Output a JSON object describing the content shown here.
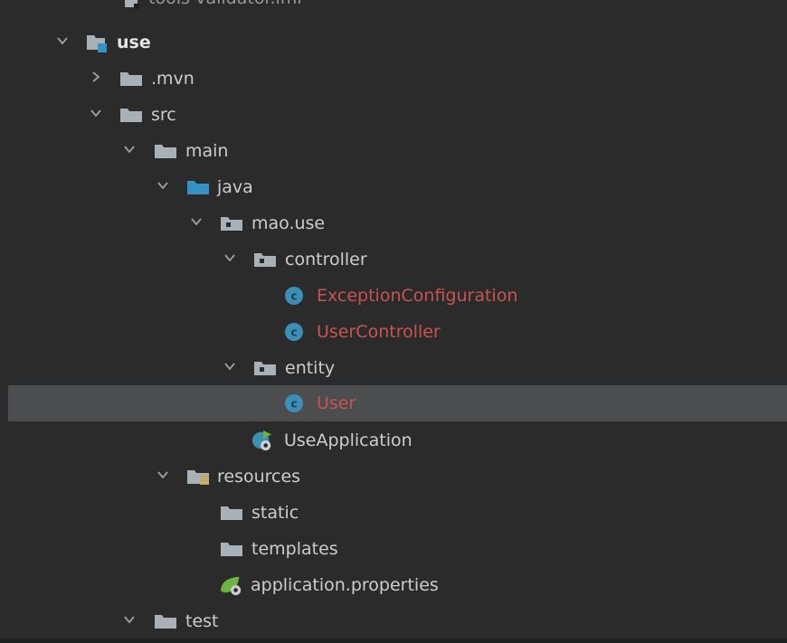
{
  "tree": {
    "partial_top": "tools-validator.iml",
    "use": ".mvn",
    "items": [
      {
        "label": "use"
      },
      {
        "label": ".mvn"
      },
      {
        "label": "src"
      },
      {
        "label": "main"
      },
      {
        "label": "java"
      },
      {
        "label": "mao.use"
      },
      {
        "label": "controller"
      },
      {
        "label": "ExceptionConfiguration"
      },
      {
        "label": "UserController"
      },
      {
        "label": "entity"
      },
      {
        "label": "User"
      },
      {
        "label": "UseApplication"
      },
      {
        "label": "resources"
      },
      {
        "label": "static"
      },
      {
        "label": "templates"
      },
      {
        "label": "application.properties"
      },
      {
        "label": "test"
      }
    ]
  },
  "colors": {
    "background": "#2b2b2b",
    "selected_row": "#4b4d4f",
    "folder": "#a9b1b8",
    "source_folder": "#3592c4",
    "class_icon": "#3b8eb5",
    "error_text": "#c75450",
    "spring_green": "#6db33f",
    "resources_marker": "#d6a828"
  }
}
